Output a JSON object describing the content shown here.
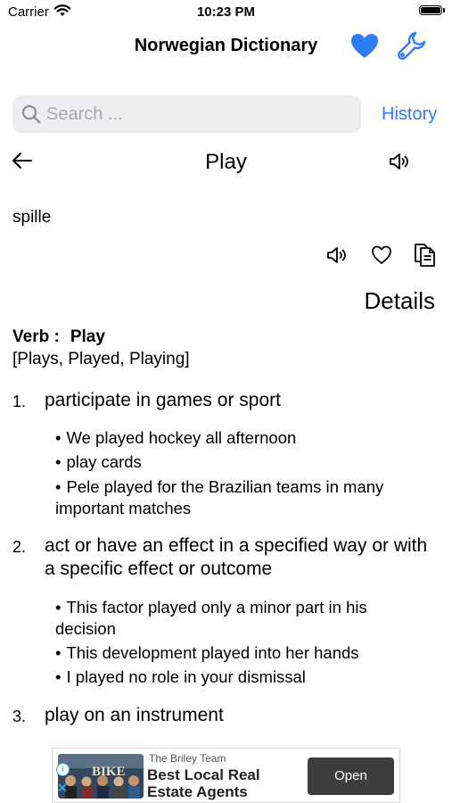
{
  "status_bar": {
    "carrier": "Carrier",
    "time": "10:23 PM"
  },
  "header": {
    "title": "Norwegian Dictionary",
    "favorites_icon": "heart-filled-icon",
    "settings_icon": "wrench-icon",
    "accent": "#2f7cf6"
  },
  "search": {
    "placeholder": "Search ...",
    "value": "",
    "history_label": "History"
  },
  "word": {
    "title": "Play",
    "translation": "spille",
    "details_label": "Details",
    "part_of_speech": "Verb :",
    "headword": "Play",
    "forms": "[Plays, Played, Playing]"
  },
  "definitions": [
    {
      "number": "1.",
      "text": "participate in games or sport",
      "examples": [
        "We played hockey all afternoon",
        "play cards",
        "Pele played for the Brazilian teams in many important matches"
      ]
    },
    {
      "number": "2.",
      "text": "act or have an effect in a specified way or with a specific effect or outcome",
      "examples": [
        "This factor played only a minor part in his decision",
        "This development played into her hands",
        "I played no role in your dismissal"
      ]
    },
    {
      "number": "3.",
      "text": "play on an instrument",
      "examples": []
    }
  ],
  "ad": {
    "brand": "The Briley Team",
    "title": "Best Local Real Estate Agents",
    "button": "Open",
    "image_text": "BIKE"
  }
}
